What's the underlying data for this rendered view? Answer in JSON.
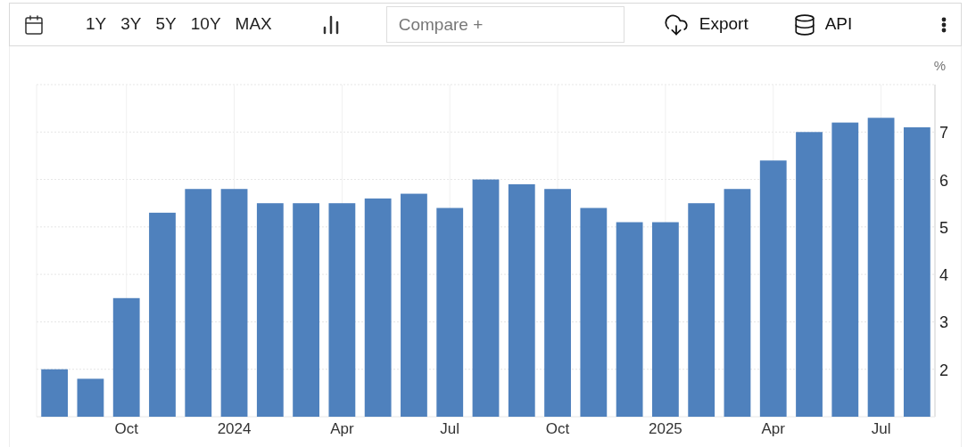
{
  "toolbar": {
    "ranges": [
      "1Y",
      "3Y",
      "5Y",
      "10Y",
      "MAX"
    ],
    "compare": {
      "placeholder": "Compare +"
    },
    "export_label": "Export",
    "api_label": "API"
  },
  "chart": {
    "unit": "%",
    "chart_data": {
      "type": "bar",
      "categories": [
        null,
        null,
        "Oct",
        null,
        null,
        "2024",
        null,
        null,
        "Apr",
        null,
        null,
        "Jul",
        null,
        null,
        "Oct",
        null,
        null,
        "2025",
        null,
        null,
        "Apr",
        null,
        null,
        "Jul",
        null
      ],
      "grid": true,
      "series": [
        {
          "color": "#4f81bd",
          "values": [
            2.0,
            1.8,
            3.5,
            5.3,
            5.8,
            5.8,
            5.5,
            5.5,
            5.5,
            5.6,
            5.7,
            5.4,
            6.0,
            5.9,
            5.8,
            5.4,
            5.1,
            5.1,
            5.5,
            5.8,
            6.4,
            7.0,
            7.2,
            7.3,
            7.1
          ]
        }
      ],
      "ylim": [
        1,
        8
      ],
      "yticks": [
        2,
        3,
        4,
        5,
        6,
        7
      ]
    }
  }
}
